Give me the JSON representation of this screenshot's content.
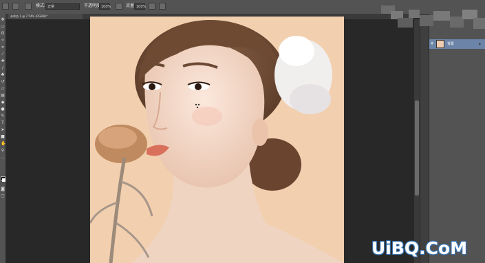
{
  "options_bar": {
    "mode_label": "模式:",
    "mode_value": "正常",
    "opacity_label": "不透明度:",
    "opacity_value": "100%",
    "flow_label": "流量:",
    "flow_value": "100%"
  },
  "document_tab": {
    "title": "未命名-1 @ 7.54% (RGB/8)*"
  },
  "layers_panel": {
    "layer_name": "背景"
  },
  "watermark": "UiBQ.CoM",
  "colors": {
    "ui_panel": "#535353",
    "workspace": "#282828",
    "layer_selected": "#6b84a8",
    "photo_bg": "#f2cfae"
  }
}
